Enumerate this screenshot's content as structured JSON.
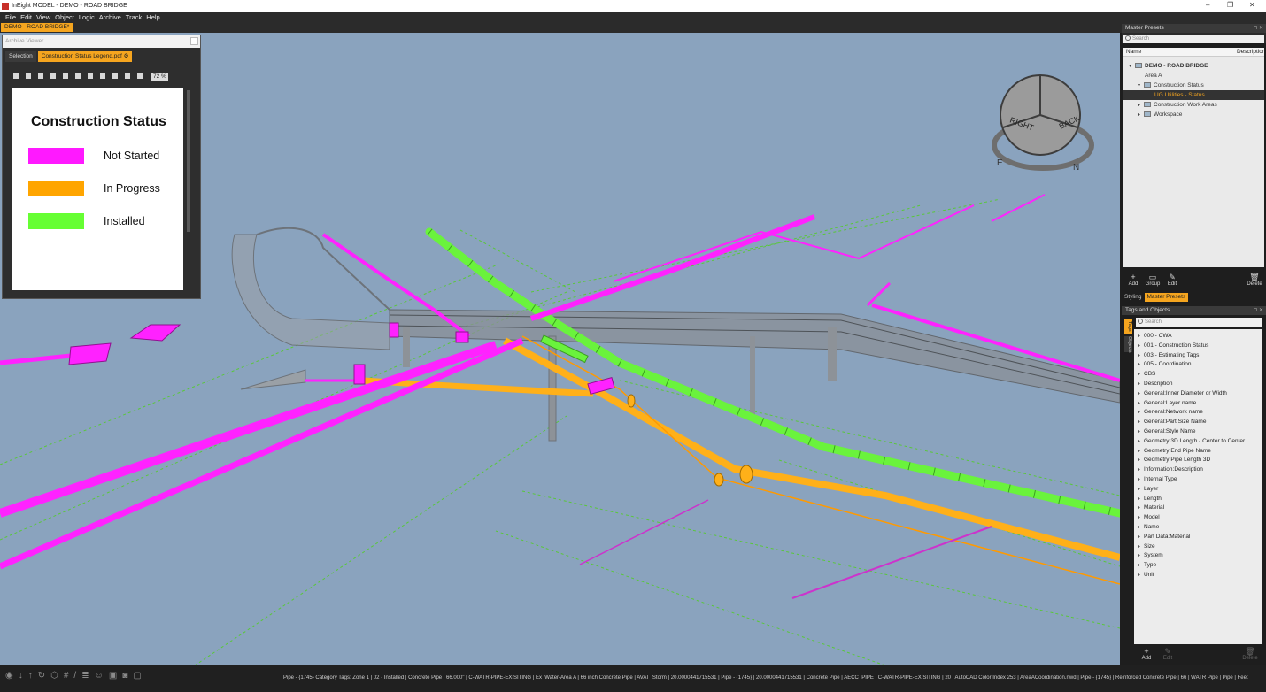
{
  "window": {
    "title": "InEight MODEL - DEMO - ROAD BRIDGE",
    "controls": [
      "–",
      "❐",
      "✕"
    ]
  },
  "menu": [
    "File",
    "Edit",
    "View",
    "Object",
    "Logic",
    "Archive",
    "Track",
    "Help"
  ],
  "document_tab": "DEMO - ROAD BRIDGE*",
  "archive_viewer": {
    "header": "Archive Viewer",
    "tabs": [
      "Selection",
      "Construction Status Legend.pdf"
    ],
    "zoom": "72 %",
    "pdf": {
      "title": "Construction Status",
      "legend": [
        {
          "label": "Not Started",
          "color": "#ff19ff"
        },
        {
          "label": "In Progress",
          "color": "#ffa500"
        },
        {
          "label": "Installed",
          "color": "#66ff33"
        }
      ]
    }
  },
  "viewcube": {
    "faces": [
      "RIGHT",
      "BACK"
    ],
    "compass": [
      "E",
      "N"
    ]
  },
  "master_presets": {
    "title": "Master Presets",
    "search_placeholder": "Search",
    "columns": [
      "Name",
      "Description"
    ],
    "tree": [
      {
        "label": "DEMO - ROAD BRIDGE"
      },
      {
        "label": "Area A"
      },
      {
        "label": "Construction Status"
      },
      {
        "label": "UG Utilities - Status",
        "selected": true
      },
      {
        "label": "Construction Work Areas"
      },
      {
        "label": "Workspace"
      }
    ],
    "actions": [
      "Add",
      "Group",
      "Edit",
      "Delete"
    ],
    "tabs": [
      "Styling",
      "Master Presets"
    ]
  },
  "tags_objects": {
    "title": "Tags and Objects",
    "search_placeholder": "Search",
    "vtabs": [
      "Tags",
      "Objects"
    ],
    "items": [
      "000 - CWA",
      "001 - Construction Status",
      "003 - Estimating Tags",
      "005 - Coordination",
      "CBS",
      "Description",
      "General:Inner Diameter or Width",
      "General:Layer name",
      "General:Network name",
      "General:Part Size Name",
      "General:Style Name",
      "Geometry:3D Length - Center to Center",
      "Geometry:End Pipe Name",
      "Geometry:Pipe Length 3D",
      "Information:Description",
      "Internal Type",
      "Layer",
      "Length",
      "Material",
      "Model",
      "Name",
      "Part Data:Material",
      "Size",
      "System",
      "Type",
      "Unit"
    ],
    "actions": [
      "Add",
      "Edit",
      "Delete"
    ]
  },
  "status_bar": {
    "text": "Pipe - {1745}     Category Tags: Zone 1 | 02 - Installed | Concrete Pipe | 66.000\" | C-WATR-PIPE-EXISITING | Ex_Water-Area A | 66 inch Concrete Pipe | AVAT_Storm | 20.0000441715531 | Pipe - {1745} | 20.0000441715531 | Concrete Pipe | AECC_PIPE | C-WATR-PIPE-EXISITING | 20 | AutoCAD Color Index 253 | AreaACoordination.nwd | Pipe - {1745} | Reinforced Concrete Pipe | 66 | WATR Pipe | Pipe | Feet"
  }
}
